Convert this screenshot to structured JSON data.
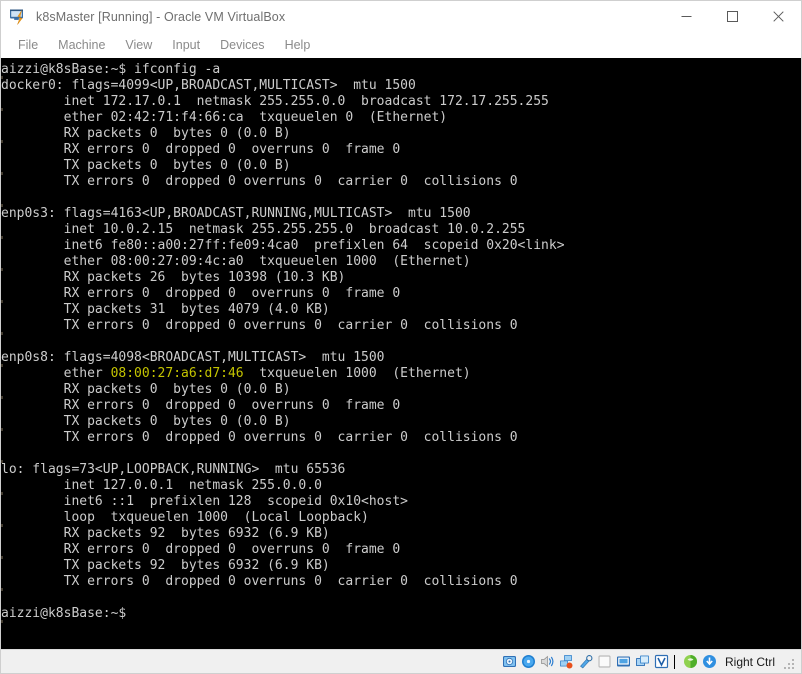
{
  "window": {
    "title": "k8sMaster [Running] - Oracle VM VirtualBox",
    "app_icon": "virtualbox-icon",
    "controls": {
      "minimize": "—",
      "maximize": "☐",
      "close": "✕"
    }
  },
  "menubar": {
    "items": [
      {
        "label": "File",
        "name": "menu-file"
      },
      {
        "label": "Machine",
        "name": "menu-machine"
      },
      {
        "label": "View",
        "name": "menu-view"
      },
      {
        "label": "Input",
        "name": "menu-input"
      },
      {
        "label": "Devices",
        "name": "menu-devices"
      },
      {
        "label": "Help",
        "name": "menu-help"
      }
    ]
  },
  "terminal": {
    "prompt": "aizzi@k8sBase:~$",
    "command": "ifconfig -a",
    "foreground": "#cccccc",
    "background": "#000000",
    "highlight_color": "#c4c400",
    "lines": [
      {
        "text": "aizzi@k8sBase:~$ ifconfig -a"
      },
      {
        "text": "docker0: flags=4099<UP,BROADCAST,MULTICAST>  mtu 1500"
      },
      {
        "text": "        inet 172.17.0.1  netmask 255.255.0.0  broadcast 172.17.255.255"
      },
      {
        "text": "        ether 02:42:71:f4:66:ca  txqueuelen 0  (Ethernet)"
      },
      {
        "text": "        RX packets 0  bytes 0 (0.0 B)"
      },
      {
        "text": "        RX errors 0  dropped 0  overruns 0  frame 0"
      },
      {
        "text": "        TX packets 0  bytes 0 (0.0 B)"
      },
      {
        "text": "        TX errors 0  dropped 0 overruns 0  carrier 0  collisions 0"
      },
      {
        "text": ""
      },
      {
        "text": "enp0s3: flags=4163<UP,BROADCAST,RUNNING,MULTICAST>  mtu 1500"
      },
      {
        "text": "        inet 10.0.2.15  netmask 255.255.255.0  broadcast 10.0.2.255"
      },
      {
        "text": "        inet6 fe80::a00:27ff:fe09:4ca0  prefixlen 64  scopeid 0x20<link>"
      },
      {
        "text": "        ether 08:00:27:09:4c:a0  txqueuelen 1000  (Ethernet)"
      },
      {
        "text": "        RX packets 26  bytes 10398 (10.3 KB)"
      },
      {
        "text": "        RX errors 0  dropped 0  overruns 0  frame 0"
      },
      {
        "text": "        TX packets 31  bytes 4079 (4.0 KB)"
      },
      {
        "text": "        TX errors 0  dropped 0 overruns 0  carrier 0  collisions 0"
      },
      {
        "text": ""
      },
      {
        "text": "enp0s8: flags=4098<BROADCAST,MULTICAST>  mtu 1500"
      },
      {
        "pre": "        ether ",
        "hl": "08:00:27:a6:d7:46",
        "post": "  txqueuelen 1000  (Ethernet)"
      },
      {
        "text": "        RX packets 0  bytes 0 (0.0 B)"
      },
      {
        "text": "        RX errors 0  dropped 0  overruns 0  frame 0"
      },
      {
        "text": "        TX packets 0  bytes 0 (0.0 B)"
      },
      {
        "text": "        TX errors 0  dropped 0 overruns 0  carrier 0  collisions 0"
      },
      {
        "text": ""
      },
      {
        "text": "lo: flags=73<UP,LOOPBACK,RUNNING>  mtu 65536"
      },
      {
        "text": "        inet 127.0.0.1  netmask 255.0.0.0"
      },
      {
        "text": "        inet6 ::1  prefixlen 128  scopeid 0x10<host>"
      },
      {
        "text": "        loop  txqueuelen 1000  (Local Loopback)"
      },
      {
        "text": "        RX packets 92  bytes 6932 (6.9 KB)"
      },
      {
        "text": "        RX errors 0  dropped 0  overruns 0  frame 0"
      },
      {
        "text": "        TX packets 92  bytes 6932 (6.9 KB)"
      },
      {
        "text": "        TX errors 0  dropped 0 overruns 0  carrier 0  collisions 0"
      },
      {
        "text": ""
      },
      {
        "text": "aizzi@k8sBase:~$ "
      }
    ]
  },
  "statusbar": {
    "icons": [
      {
        "name": "hard-disk-icon",
        "title": "Hard Disks"
      },
      {
        "name": "optical-disk-icon",
        "title": "Optical Drives"
      },
      {
        "name": "audio-icon",
        "title": "Audio"
      },
      {
        "name": "network-icon",
        "title": "Network"
      },
      {
        "name": "usb-icon",
        "title": "USB Devices"
      },
      {
        "name": "shared-folders-icon",
        "title": "Shared Folders"
      },
      {
        "name": "display-icon",
        "title": "Display"
      },
      {
        "name": "recording-icon",
        "title": "Recording"
      },
      {
        "name": "vm-features-icon",
        "title": "VM Features"
      },
      {
        "name": "mouse-capture-icon",
        "title": "Mouse Integration"
      },
      {
        "name": "keyboard-icon",
        "title": "Keyboard"
      }
    ],
    "host_key": "Right Ctrl",
    "resize_grip": "resize-grip"
  }
}
